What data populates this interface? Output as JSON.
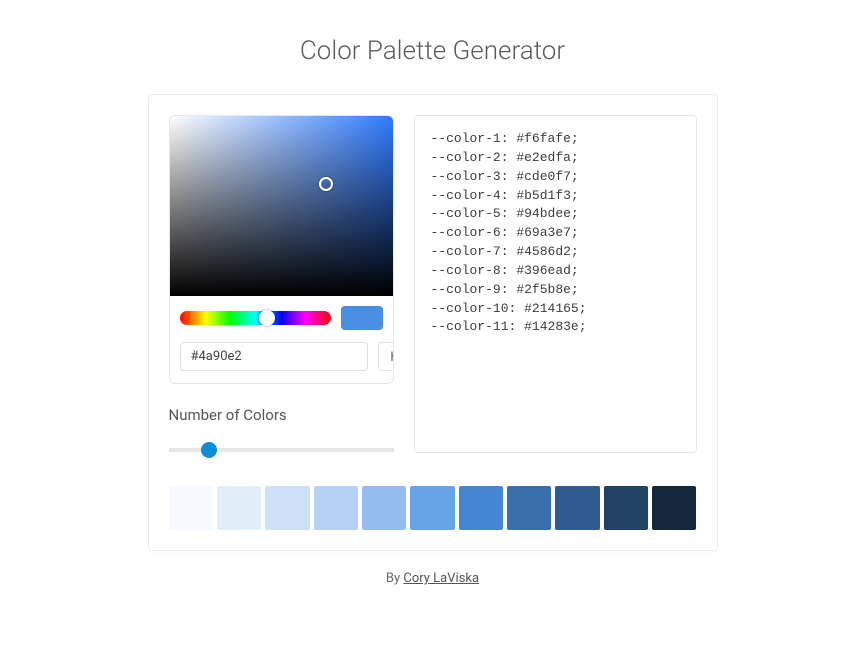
{
  "title": "Color Palette Generator",
  "picker": {
    "hex_value": "#4a90e2",
    "format_button": "hex",
    "preview_color": "#4a90e2"
  },
  "number_of_colors": {
    "label": "Number of Colors",
    "value": 11,
    "min": 3,
    "max": 40
  },
  "css_vars": [
    {
      "name": "--color-1",
      "value": "#f6fafe"
    },
    {
      "name": "--color-2",
      "value": "#e2edfa"
    },
    {
      "name": "--color-3",
      "value": "#cde0f7"
    },
    {
      "name": "--color-4",
      "value": "#b5d1f3"
    },
    {
      "name": "--color-5",
      "value": "#94bdee"
    },
    {
      "name": "--color-6",
      "value": "#69a3e7"
    },
    {
      "name": "--color-7",
      "value": "#4586d2"
    },
    {
      "name": "--color-8",
      "value": "#396ead"
    },
    {
      "name": "--color-9",
      "value": "#2f5b8e"
    },
    {
      "name": "--color-10",
      "value": "#214165"
    },
    {
      "name": "--color-11",
      "value": "#14283e"
    }
  ],
  "footer": {
    "by": "By ",
    "author": "Cory LaViska"
  }
}
